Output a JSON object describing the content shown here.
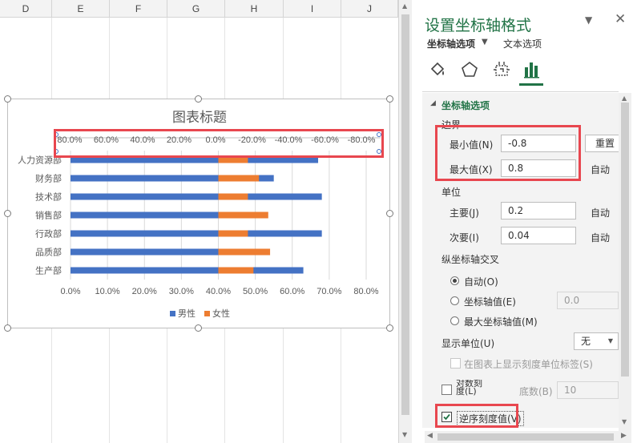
{
  "sheet": {
    "columns": [
      "D",
      "E",
      "F",
      "G",
      "H",
      "I",
      "J"
    ]
  },
  "chart": {
    "title": "图表标题"
  },
  "chart_data": {
    "type": "bar",
    "orientation": "horizontal",
    "stacked": true,
    "categories": [
      "人力资源部",
      "财务部",
      "技术部",
      "销售部",
      "行政部",
      "品质部",
      "生产部"
    ],
    "series": [
      {
        "name": "男性",
        "color": "#4472c4",
        "values": [
          0.67,
          0.55,
          0.68,
          0.45,
          0.68,
          0.44,
          0.63
        ]
      },
      {
        "name": "女性",
        "color": "#ed7d31",
        "values": [
          -0.16,
          -0.22,
          -0.16,
          -0.27,
          -0.16,
          -0.28,
          -0.19
        ]
      }
    ],
    "primary_axis": {
      "ticks": [
        "0.0%",
        "10.0%",
        "20.0%",
        "30.0%",
        "40.0%",
        "50.0%",
        "60.0%",
        "70.0%",
        "80.0%"
      ]
    },
    "secondary_axis": {
      "min": -0.8,
      "max": 0.8,
      "major_unit": 0.2,
      "reversed": true,
      "ticks": [
        "80.0%",
        "60.0%",
        "40.0%",
        "20.0%",
        "0.0%",
        "-20.0%",
        "-40.0%",
        "-60.0%",
        "-80.0%"
      ]
    },
    "grid": true,
    "legend": "bottom"
  },
  "pane": {
    "title": "设置坐标轴格式",
    "tab_axis_options": "坐标轴选项",
    "tab_text_options": "文本选项",
    "tools": [
      "fill-line-icon",
      "effects-icon",
      "size-properties-icon",
      "axis-options-icon"
    ],
    "section_title": "坐标轴选项",
    "bounds_label": "边界",
    "min_label": "最小值(N)",
    "min_value": "-0.8",
    "reset_label": "重置",
    "max_label": "最大值(X)",
    "max_value": "0.8",
    "auto_label": "自动",
    "units_label": "单位",
    "major_label": "主要(J)",
    "major_value": "0.2",
    "minor_label": "次要(I)",
    "minor_value": "0.04",
    "cross_label": "纵坐标轴交叉",
    "cross_auto": "自动(O)",
    "cross_value_label": "坐标轴值(E)",
    "cross_value": "0.0",
    "cross_max": "最大坐标轴值(M)",
    "display_units_label": "显示单位(U)",
    "display_units_value": "无",
    "show_units_label": "在图表上显示刻度单位标签(S)",
    "log_label": "对数刻度(L)",
    "base_label": "底数(B)",
    "base_value": "10",
    "reverse_label": "逆序刻度值(V)"
  },
  "colors": {
    "accent": "#217346",
    "highlight": "#e8474f",
    "male": "#4472c4",
    "female": "#ed7d31"
  }
}
